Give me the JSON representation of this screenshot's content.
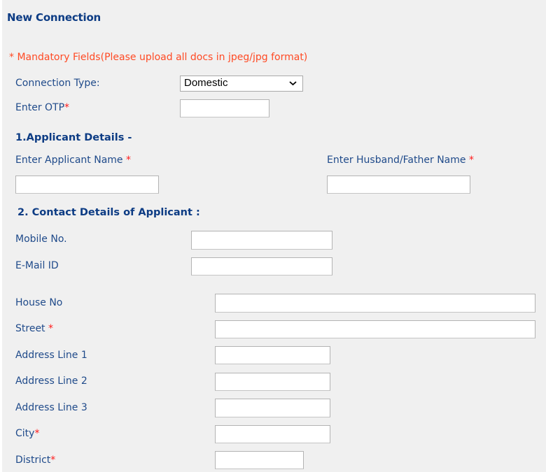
{
  "page": {
    "title": "New Connection",
    "mandatory_note": "* Mandatory Fields(Please upload all docs in jpeg/jpg format)",
    "required_marker": "*"
  },
  "colors": {
    "title": "#0d3c84",
    "label": "#1f4a8a",
    "mandatory_note": "#ff4a24",
    "required_star": "#ff1a1a",
    "background": "#f0f0f0"
  },
  "connection": {
    "type_label": "Connection Type:",
    "type_value": "Domestic",
    "otp_label": "Enter OTP",
    "otp_value": ""
  },
  "applicant": {
    "heading": "1.Applicant Details -",
    "name_label": "Enter Applicant Name ",
    "name_value": "",
    "guardian_label": "Enter Husband/Father Name ",
    "guardian_value": ""
  },
  "contact": {
    "heading": "2. Contact Details of Applicant  :",
    "mobile_label": "Mobile No.",
    "mobile_value": "",
    "email_label": "E-Mail ID",
    "email_value": ""
  },
  "address": {
    "house_label": "House No",
    "street_label": "Street ",
    "line1_label": "Address Line 1",
    "line2_label": "Address Line 2",
    "line3_label": "Address Line 3",
    "city_label": "City",
    "district_label": "District"
  },
  "icons": {
    "select_arrow": "chevron-down-icon"
  }
}
